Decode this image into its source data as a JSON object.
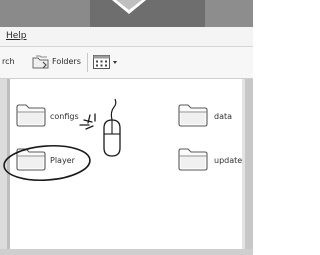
{
  "menu": {
    "help_label": "Help"
  },
  "toolbar": {
    "search_label": "rch",
    "folders_label": "Folders"
  },
  "folders": [
    {
      "name": "configs"
    },
    {
      "name": "data"
    },
    {
      "name": "Player"
    },
    {
      "name": "update"
    }
  ],
  "icons": {
    "folders_button": "folder-icon",
    "views_button": "view-grid-icon",
    "cursor": "mouse-icon"
  },
  "colors": {
    "titlebar": "#7d7d7d",
    "content": "#ffffff",
    "annotation_ink": "#1a1a1a"
  }
}
